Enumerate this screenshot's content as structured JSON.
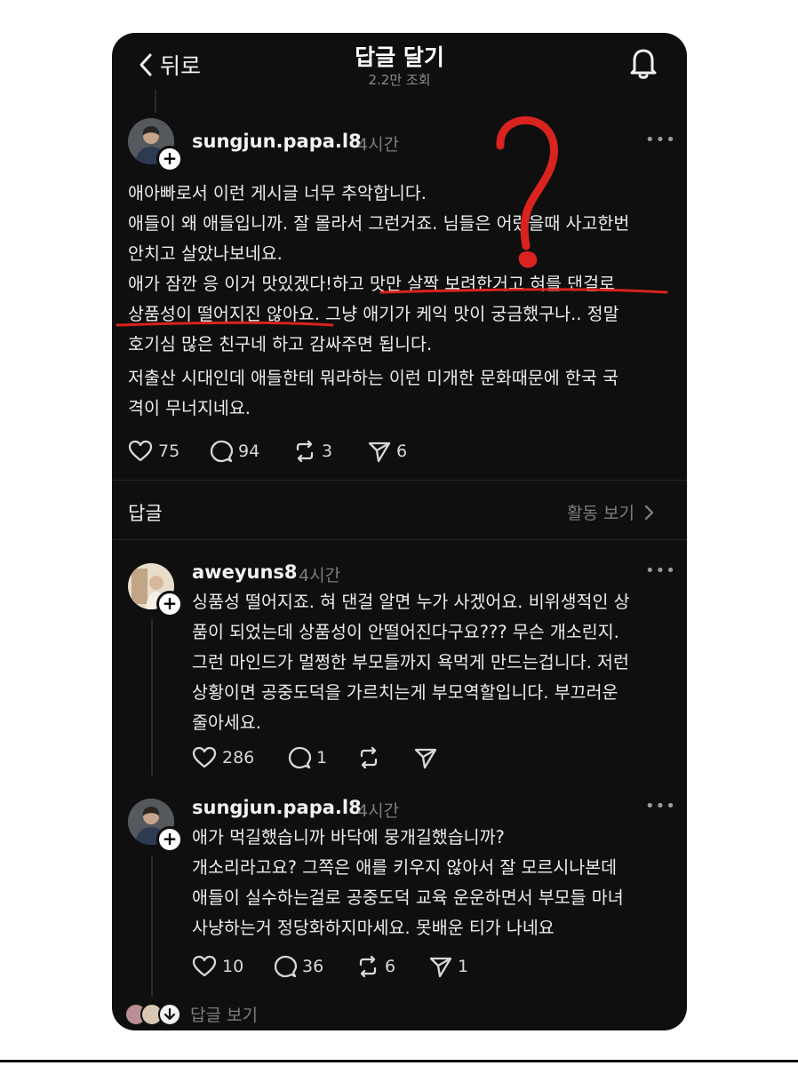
{
  "header": {
    "back_label": "뒤로",
    "title": "답글 달기",
    "views": "2.2만 조회"
  },
  "post": {
    "username": "sungjun.papa.l8",
    "time": "4시간",
    "paragraph1": "애아빠로서 이런 게시글 너무 추악합니다.\n애들이 왜 애들입니까. 잘 몰라서 그런거죠. 님들은 어렸을때 사고한번\n안치고 살았나보네요.\n애가 잠깐 응 이거 맛있겠다!하고 맛만 살짝 보려한거고 혀를 댄걸로\n상품성이 떨어지진 않아요. 그냥 애기가 케익 맛이 궁금했구나.. 정말\n호기심 많은 친구네 하고 감싸주면 됩니다.",
    "paragraph2": "저출산 시대인데 애들한테 뭐라하는 이런 미개한 문화때문에 한국 국\n격이 무너지네요.",
    "likes": "75",
    "comments": "94",
    "reposts": "3",
    "shares": "6"
  },
  "replies_section": {
    "title": "답글",
    "activity_link": "활동 보기"
  },
  "reply1": {
    "username": "aweyuns8",
    "time": "4시간",
    "text": "싱품성 떨어지죠. 혀 댄걸 알면 누가 사겠어요. 비위생적인 상\n품이 되었는데 상품성이 안떨어진다구요??? 무슨 개소린지.\n그런 마인드가 멀쩡한 부모들까지 욕먹게 만드는겁니다. 저런\n상황이면 공중도덕을 가르치는게 부모역할입니다. 부끄러운\n줄아세요.",
    "likes": "286",
    "comments": "1"
  },
  "reply2": {
    "username": "sungjun.papa.l8",
    "time": "4시간",
    "text": "애가 먹길했습니까 바닥에 뭉개길했습니까?\n개소리라고요? 그쪽은 애를 키우지 않아서 잘 모르시나본데\n애들이 실수하는걸로 공중도덕 교육 운운하면서 부모들 마녀\n사냥하는거 정당화하지마세요. 못배운 티가 나네요",
    "likes": "10",
    "comments": "36",
    "reposts": "6",
    "shares": "1"
  },
  "footer": {
    "view_replies": "답글 보기"
  },
  "icons": [
    "chevron-left-icon",
    "bell-icon",
    "more-icon",
    "heart-icon",
    "comment-icon",
    "repost-icon",
    "send-icon",
    "chevron-right-icon",
    "plus-icon",
    "arrow-down-icon"
  ],
  "colors": {
    "background": "#0f0f0f",
    "annotation_red": "#d9231f",
    "muted": "#7d7d7d"
  }
}
